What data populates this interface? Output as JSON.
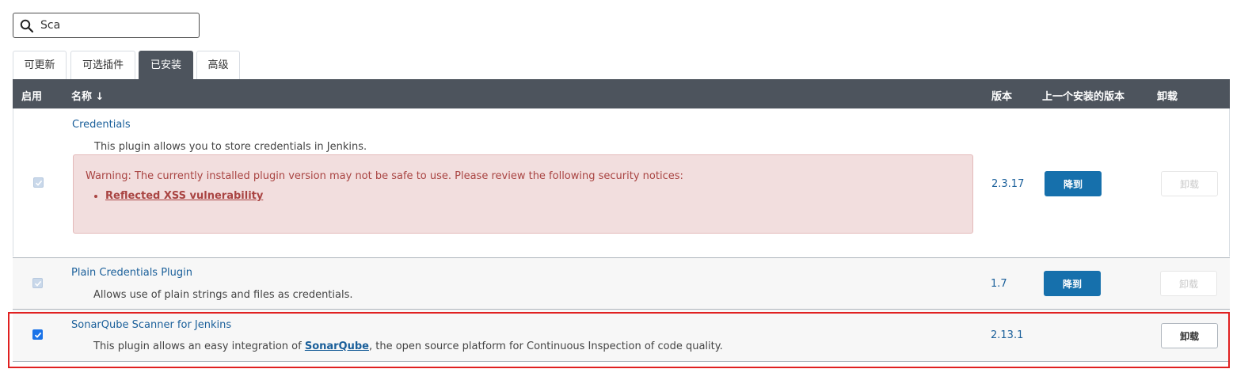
{
  "search": {
    "value": "Sca",
    "placeholder": ""
  },
  "tabs": [
    {
      "label": "可更新",
      "active": false
    },
    {
      "label": "可选插件",
      "active": false
    },
    {
      "label": "已安装",
      "active": true
    },
    {
      "label": "高级",
      "active": false
    }
  ],
  "table": {
    "headers": {
      "enabled": "启用",
      "name": "名称 ↓",
      "version": "版本",
      "previous": "上一个安装的版本",
      "uninstall": "卸载"
    },
    "rows": [
      {
        "name": "Credentials",
        "description": "This plugin allows you to store credentials in Jenkins.",
        "warning": {
          "message": "Warning: The currently installed plugin version may not be safe to use. Please review the following security notices:",
          "link": "Reflected XSS vulnerability"
        },
        "version": "2.3.17",
        "downgrade_label": "降到",
        "uninstall_label": "卸载",
        "checked": true,
        "checkbox_disabled": true,
        "uninstall_enabled": false
      },
      {
        "name": "Plain Credentials Plugin",
        "description": "Allows use of plain strings and files as credentials.",
        "version": "1.7",
        "downgrade_label": "降到",
        "uninstall_label": "卸载",
        "checked": true,
        "checkbox_disabled": true,
        "uninstall_enabled": false
      },
      {
        "name": "SonarQube Scanner for Jenkins",
        "description_before": "This plugin allows an easy integration of ",
        "description_link": "SonarQube",
        "description_after": ", the open source platform for Continuous Inspection of code quality.",
        "version": "2.13.1",
        "uninstall_label": "卸载",
        "checked": true,
        "checkbox_disabled": false,
        "uninstall_enabled": true
      }
    ]
  },
  "colors": {
    "header_bg": "#4d545d",
    "link": "#1a5f9a",
    "warning_bg": "#f2dede",
    "warning_text": "#a94442",
    "button_primary": "#1670ac",
    "highlight_border": "#e02020"
  }
}
